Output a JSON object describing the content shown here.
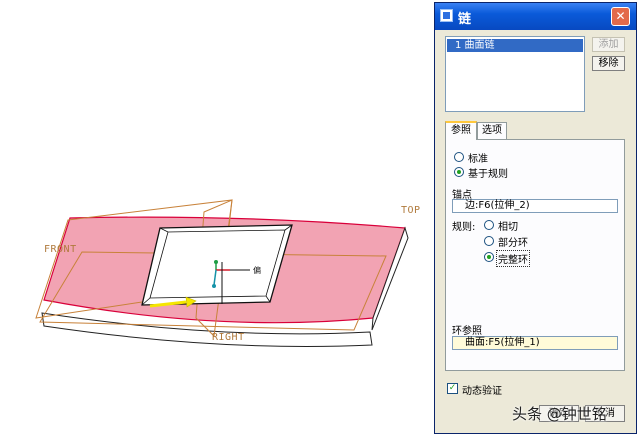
{
  "viewport": {
    "labels": {
      "top": "TOP",
      "front": "FRONT",
      "right": "RIGHT"
    },
    "colors": {
      "highlight_surface": "#f2a3b3",
      "edge": "#d9003a",
      "datum": "#c8823a",
      "arrow": "#f5e600"
    }
  },
  "dialog": {
    "title": "链",
    "close_icon": "close-icon",
    "chain_list": {
      "items": [
        "1  曲面链"
      ]
    },
    "buttons": {
      "add": "添加",
      "remove": "移除"
    },
    "tabs": [
      "参照",
      "选项"
    ],
    "active_tab": 0,
    "reference": {
      "type_options": [
        "标准",
        "基于规则"
      ],
      "type_selected": 1,
      "anchor_label": "锚点",
      "anchor_value": "边:F6(拉伸_2)",
      "rule_label": "规则:",
      "rule_options": [
        "相切",
        "部分环",
        "完整环"
      ],
      "rule_selected": 2,
      "loop_ref_label": "环参照",
      "loop_ref_value": "曲面:F5(拉伸_1)"
    },
    "dynamic_verify": {
      "label": "动态验证",
      "checked": true
    },
    "footer_buttons": [
      "确定",
      "取消"
    ]
  },
  "watermark": "头条 @钟世铭"
}
